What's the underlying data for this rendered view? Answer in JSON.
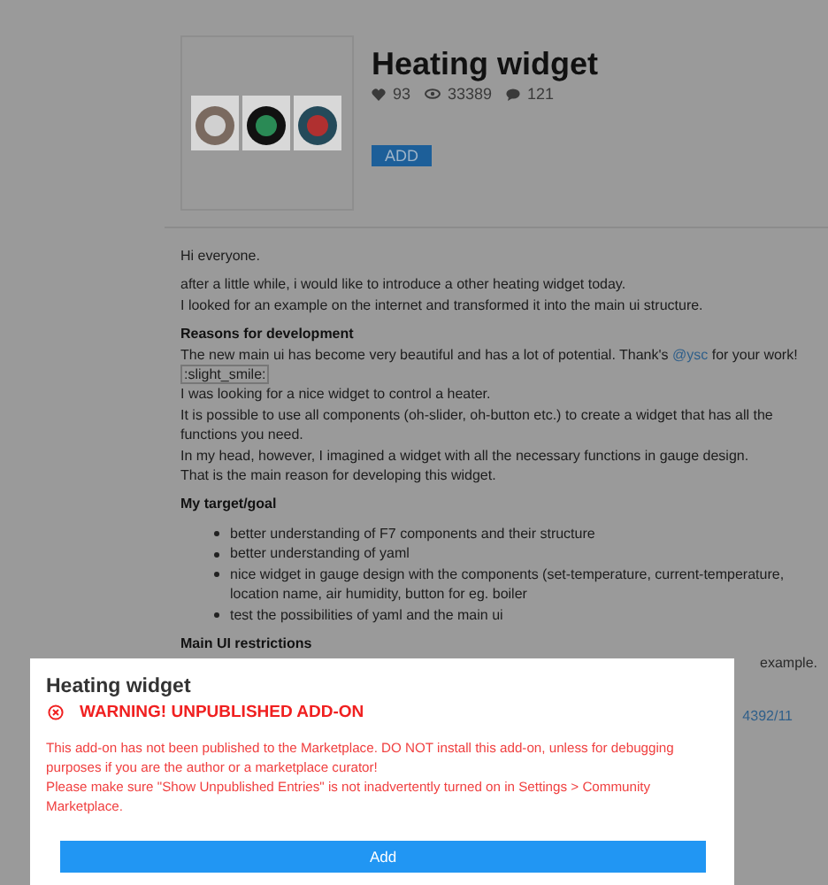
{
  "addon": {
    "title": "Heating widget",
    "likes": "93",
    "views": "33389",
    "comments": "121",
    "add_button": "ADD"
  },
  "post": {
    "greeting": "Hi everyone.",
    "intro": [
      "after a little while, i would like to introduce a other heating widget today.",
      "I looked for an example on the internet and transformed it into the main ui structure."
    ],
    "sections": [
      {
        "heading": "Reasons for development",
        "lines": [
          {
            "kind": "mention",
            "before": "The new main ui has become very beautiful and has a lot of potential. Thank's ",
            "mention": "@ysc",
            "after": " for your work! ",
            "emoji": ":slight_smile:"
          },
          {
            "kind": "text",
            "text": "I was looking for a nice widget to control a heater."
          },
          {
            "kind": "text",
            "text": "It is possible to use all components (oh-slider, oh-button etc.) to create a widget that has all the functions you need."
          },
          {
            "kind": "text",
            "text": "In my head, however, I imagined a widget with all the necessary functions in gauge design."
          },
          {
            "kind": "text",
            "text": "That is the main reason for developing this widget."
          }
        ]
      },
      {
        "heading": "My target/goal",
        "lines": [
          {
            "kind": "bullet",
            "text": "better understanding of F7 components and their structure"
          },
          {
            "kind": "bullet",
            "text": "better understanding of yaml"
          },
          {
            "kind": "bullet",
            "text": "nice widget in gauge design with the components (set-temperature, current-temperature, location name, air humidity, button for eg. boiler"
          },
          {
            "kind": "bullet",
            "text": "test the possibilities of yaml and the main ui"
          }
        ]
      },
      {
        "heading": "Main UI restrictions",
        "lines": [
          {
            "kind": "fragment",
            "text": "example."
          },
          {
            "kind": "fragment",
            "text": "4392/11"
          }
        ]
      }
    ]
  },
  "dialog": {
    "title": "Heating widget",
    "warning": "WARNING! UNPUBLISHED ADD-ON",
    "message": [
      "This add-on has not been published to the Marketplace. DO NOT install this add-on, unless for debugging purposes if you are the author or a marketplace curator!",
      "Please make sure \"Show Unpublished Entries\" is not inadvertently turned on in Settings > Community Marketplace."
    ],
    "add_button": "Add"
  }
}
